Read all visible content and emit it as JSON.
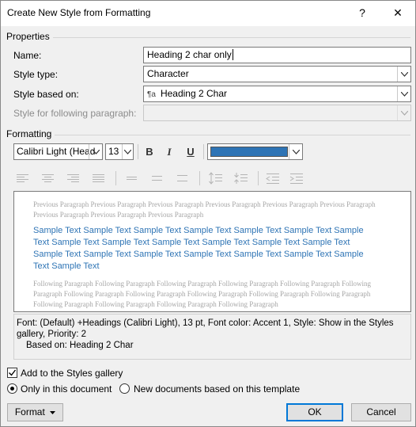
{
  "window": {
    "title": "Create New Style from Formatting",
    "help_label": "?",
    "close_label": "✕"
  },
  "properties": {
    "group_label": "Properties",
    "name_label": "Name:",
    "name_value": "Heading 2 char only",
    "style_type_label": "Style type:",
    "style_type_value": "Character",
    "based_on_label": "Style based on:",
    "based_on_value": "Heading 2 Char",
    "based_on_icon": "¶a",
    "following_label": "Style for following paragraph:",
    "following_value": ""
  },
  "formatting": {
    "group_label": "Formatting",
    "font_value": "Calibri Light (Head",
    "size_value": "13",
    "bold_label": "B",
    "italic_label": "I",
    "underline_label": "U",
    "font_color": "#2e74b5"
  },
  "preview": {
    "previous_paragraph": "Previous Paragraph Previous Paragraph Previous Paragraph Previous Paragraph Previous Paragraph Previous Paragraph Previous Paragraph Previous Paragraph Previous Paragraph",
    "sample_text": "Sample Text Sample Text Sample Text Sample Text Sample Text Sample Text Sample Text Sample Text Sample Text Sample Text Sample Text Sample Text Sample Text Sample Text Sample Text Sample Text Sample Text Sample Text Sample Text Sample Text Sample Text",
    "following_paragraph": "Following Paragraph Following Paragraph Following Paragraph Following Paragraph Following Paragraph Following Paragraph Following Paragraph Following Paragraph Following Paragraph Following Paragraph Following Paragraph Following Paragraph Following Paragraph Following Paragraph Following Paragraph"
  },
  "description": {
    "line1": "Font: (Default) +Headings (Calibri Light), 13 pt, Font color: Accent 1, Style: Show in the Styles",
    "line2": "gallery, Priority: 2",
    "line3": "Based on: Heading 2 Char"
  },
  "options": {
    "add_to_gallery_label": "Add to the Styles gallery",
    "add_to_gallery_checked": true,
    "only_this_doc_label": "Only in this document",
    "new_docs_label": "New documents based on this template"
  },
  "buttons": {
    "format_label": "Format",
    "ok_label": "OK",
    "cancel_label": "Cancel"
  }
}
